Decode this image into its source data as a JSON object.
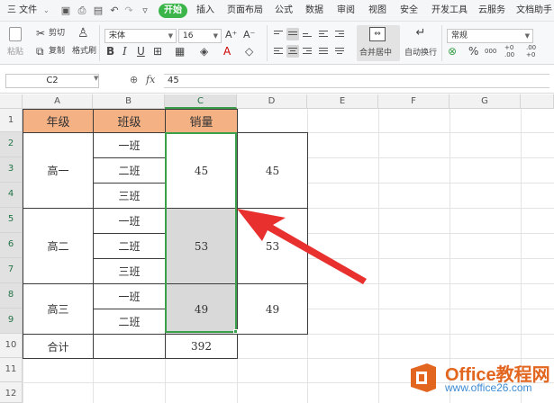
{
  "menubar": {
    "file_label": "三 文件",
    "file_arrow": "⌄",
    "start_tab": "开始",
    "tabs": [
      "插入",
      "页面布局",
      "公式",
      "数据",
      "审阅",
      "视图",
      "安全",
      "开发工具",
      "云服务",
      "文档助手"
    ]
  },
  "ribbon": {
    "paste_label": "粘贴",
    "cut_label": "剪切",
    "copy_label": "复制",
    "format_painter_label": "格式刷",
    "font_name": "宋体",
    "font_size": "16",
    "bold": "B",
    "italic": "I",
    "underline": "U",
    "grow_font": "A⁺",
    "shrink_font": "A⁻",
    "merge_center_label": "合并居中",
    "wrap_label": "自动换行",
    "number_format": "常规",
    "percent": "%",
    "thousands": "000",
    "inc_decimal": "+0 .00",
    "dec_decimal": ".00 +0"
  },
  "formula_bar": {
    "name_box": "C2",
    "fx": "fx",
    "value": "45"
  },
  "columns": [
    "A",
    "B",
    "C",
    "D",
    "E",
    "F",
    "G"
  ],
  "rows": [
    "1",
    "2",
    "3",
    "4",
    "5",
    "6",
    "7",
    "8",
    "9",
    "10",
    "11",
    "12"
  ],
  "table": {
    "headers": {
      "grade": "年级",
      "class": "班级",
      "sales": "销量"
    },
    "groups": [
      {
        "grade": "高一",
        "classes": [
          "一班",
          "二班",
          "三班"
        ],
        "sales": "45",
        "d_value": "45"
      },
      {
        "grade": "高二",
        "classes": [
          "一班",
          "二班",
          "三班"
        ],
        "sales": "53",
        "d_value": "53"
      },
      {
        "grade": "高三",
        "classes": [
          "一班",
          "二班"
        ],
        "sales": "49",
        "d_value": "49"
      }
    ],
    "total_label": "合计",
    "total_value": "392"
  },
  "watermark": {
    "title": "Office教程网",
    "url": "www.office26.com"
  },
  "colors": {
    "header_fill": "#f4b183",
    "selection": "#3aa04a",
    "arrow": "#e8302f",
    "start_tab": "#3bb54a"
  }
}
